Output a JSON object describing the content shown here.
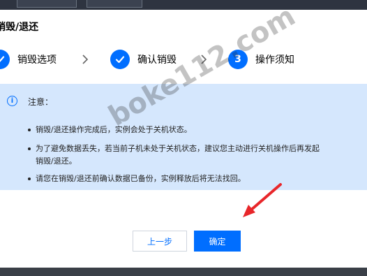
{
  "dialog": {
    "title": "销毁/退还"
  },
  "steps": [
    {
      "mark": "",
      "label": "销毁选项"
    },
    {
      "mark": "",
      "label": "确认销毁"
    },
    {
      "mark": "3",
      "label": "操作须知"
    }
  ],
  "notice": {
    "title": "注意：",
    "items": [
      "销毁/退还操作完成后，实例会处于关机状态。",
      "为了避免数据丢失，若当前子机未处于关机状态，建议您主动进行关机操作后再发起",
      "销毁/退还。",
      "请您在销毁/退还前确认数据已备份，实例释放后将无法找回。"
    ]
  },
  "buttons": {
    "prev": "上一步",
    "ok": "确定"
  },
  "watermark": "boke112.com",
  "colors": {
    "accent": "#006eff",
    "notice_bg": "#d5e7fd",
    "arrow": "#e8262a"
  }
}
